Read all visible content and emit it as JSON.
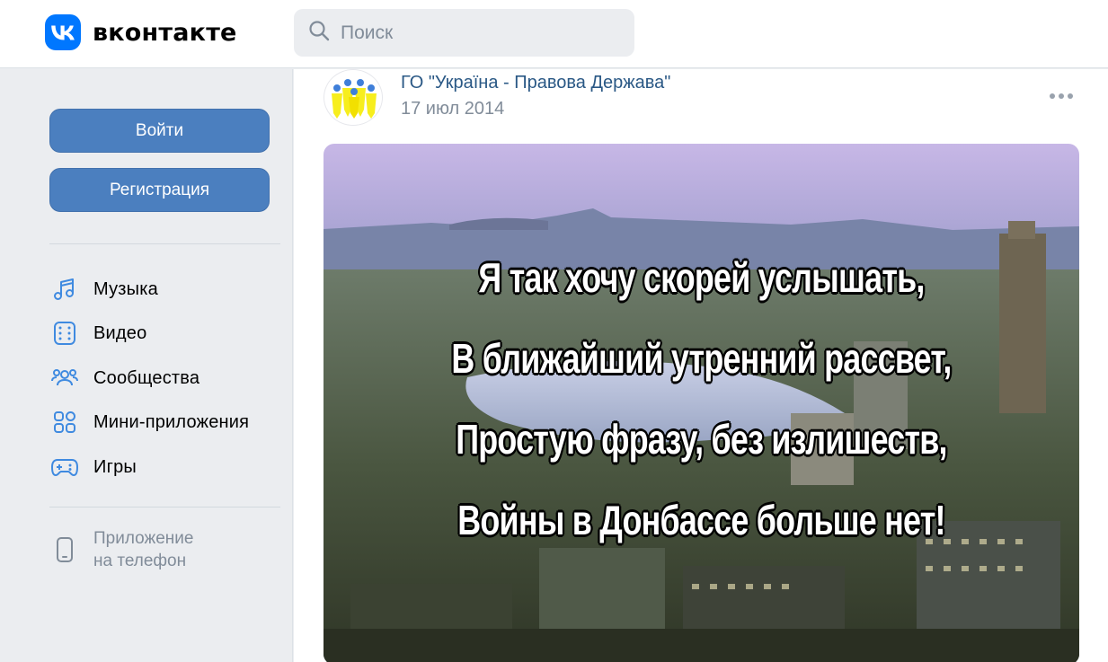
{
  "header": {
    "brand": "вконтакте",
    "search_placeholder": "Поиск"
  },
  "sidebar": {
    "login_label": "Войти",
    "register_label": "Регистрация",
    "items": [
      {
        "label": "Музыка",
        "icon": "music-icon"
      },
      {
        "label": "Видео",
        "icon": "video-icon"
      },
      {
        "label": "Сообщества",
        "icon": "communities-icon"
      },
      {
        "label": "Мини-приложения",
        "icon": "mini-apps-icon"
      },
      {
        "label": "Игры",
        "icon": "gamepad-icon"
      }
    ],
    "app": {
      "line1": "Приложение",
      "line2": "на телефон",
      "icon": "phone-icon"
    }
  },
  "post": {
    "author": "ГО \"Україна - Правова Держава\"",
    "date": "17 июл 2014",
    "image_text": [
      "Я так хочу скорей услышать,",
      "В ближайший утренний рассвет,",
      "Простую фразу, без излишеств,",
      "Войны в Донбассе больше нет!"
    ]
  },
  "colors": {
    "brand": "#0077ff",
    "button": "#4b7fbf",
    "icon": "#3f8ae0",
    "link": "#2a5885",
    "secondary_text": "#818c99"
  }
}
